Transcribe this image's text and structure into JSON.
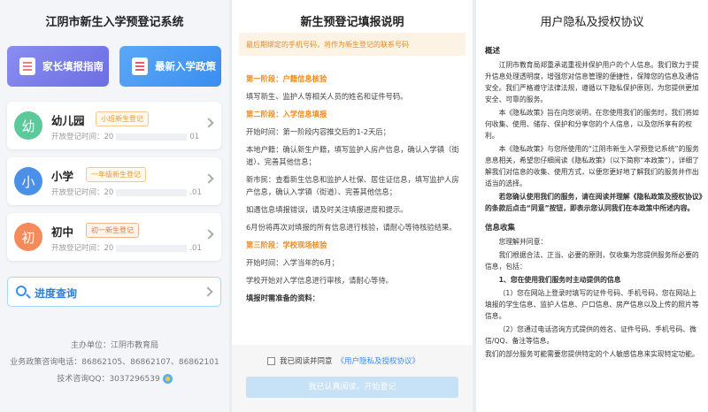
{
  "left": {
    "title": "江阴市新生入学预登记系统",
    "tiles": [
      {
        "label": "家长填报指南",
        "icon": "guide-document-icon"
      },
      {
        "label": "最新入学政策",
        "icon": "policy-document-icon"
      }
    ],
    "cards": [
      {
        "circle": "幼",
        "name": "幼儿园",
        "tag": "小班新生登记",
        "time_prefix": "开放登记时间：20",
        "time_suffix": "01"
      },
      {
        "circle": "小",
        "name": "小学",
        "tag": "一年级新生登记",
        "time_prefix": "开放登记时间：20",
        "time_suffix": ".01"
      },
      {
        "circle": "初",
        "name": "初中",
        "tag": "初一新生登记",
        "time_prefix": "开放登记时间：20",
        "time_suffix": ".01"
      }
    ],
    "progress_query": "进度查询",
    "footer": {
      "host": "主办单位：江阴市教育局",
      "phone": "业务政策咨询电话：86862105、86862107、86862101",
      "qq": "技术咨询QQ：3037296539"
    }
  },
  "middle": {
    "title": "新生预登记填报说明",
    "notice": "最后期绑定的手机号码，将作为新生登记的联系号码",
    "stage1_title": "第一阶段：户籍信息核验",
    "stage1_text": "填写新生、监护人等相关人员的姓名和证件号码。",
    "stage2_title": "第二阶段：入学信息填报",
    "stage2_p1": "开始时间：第一阶段内容推交后的1-2天后；",
    "stage2_p2": "本地户籍：确认新生户籍，填写监护人房产信息，确认入学镇（街道）、完善其他信息；",
    "stage2_p3": "新市民：查看新生信息和监护人社保、居住证信息，填写监护人房产信息，确认入学镇（街道）、完善其他信息；",
    "stage2_p4": "如遇信息填报错误，请及时关注填报进度和提示。",
    "stage2_p5": "6月份将再次对填报的所有信息进行核验，请耐心等待核验结果。",
    "stage3_title": "第三阶段：学校现场核验",
    "stage3_p1": "开始时间：入学当年的6月；",
    "stage3_p2": "学校开始对入学信息进行审核，请耐心等待。",
    "required_title": "填报时需准备的资料：",
    "agree_prefix": "我已阅读并同意",
    "agree_link": "《用户隐私及授权协议》",
    "submit": "我已认真阅读，开始登记"
  },
  "right": {
    "title": "用户隐私及授权协议",
    "overview_heading": "概述",
    "overview_p1": "江阴市教育局郑重承诺重视并保护用户的个人信息。我们致力于提升信息处理透明度，增强您对信息管理的便捷性，保障您的信息及通信安全。我们严格遵守法律法规，遵循以下隐私保护原则，为您提供更加安全、可靠的服务。",
    "overview_p2": "本《隐私政策》旨在向您说明，在您使用我们的服务时，我们将如何收集、使用、储存、保护和分享您的个人信息，以及您所享有的权利。",
    "overview_p3": "本《隐私政策》与您所使用的“江阴市新生入学预登记系统”的服务息息相关，希望您仔细阅读《隐私政策》（以下简称“本政策”），详细了解我们对信息的收集、使用方式，以便您更好地了解我们的服务并作出适当的选择。",
    "overview_p4": "若您确认使用我们的服务，请在阅读并理解《隐私政策及授权协议》的条款后点击“同意”按钮，即表示您认同我们在本政策中所述内容。",
    "collect_heading": "信息收集",
    "collect_p1": "您理解并同意：",
    "collect_p2": "我们根据合法、正当、必要的原则，仅收集为您提供服务所必要的信息，包括：",
    "collect_item1": "1、您在使用我们服务时主动提供的信息",
    "collect_p3": "（1）您在网站上登录时填写的证件号码、手机号码，您在网站上填报的学生信息、监护人信息、户口信息、房产信息以及上传的照片等信息。",
    "collect_p4": "（2）您通过电话咨询方式提供的姓名、证件号码、手机号码、微信/QQ、备注等信息。",
    "collect_p5": "我们的部分服务可能需要您提供特定的个人敏感信息来实现特定功能。"
  }
}
